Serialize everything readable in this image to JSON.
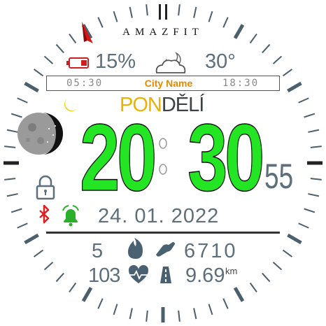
{
  "brand": "AMAZFIT",
  "battery": {
    "value": "15%",
    "color": "#cc1f1f"
  },
  "weather": {
    "temperature": "30°",
    "icon": "partly-cloudy-night-icon"
  },
  "sun": {
    "sunrise": "05:30",
    "sunset": "18:30",
    "city": "City Name"
  },
  "day": {
    "part1": "PON",
    "part2": "DĚLÍ"
  },
  "time": {
    "hours": "20",
    "minutes": "30",
    "seconds": "55"
  },
  "date": "24. 01. 2022",
  "activity": {
    "calories": "5",
    "steps": "6710",
    "heart_rate": "103",
    "distance": "9.69",
    "distance_unit": "km"
  },
  "colors": {
    "time": "#24e524",
    "accent_gray": "#5d6f7b",
    "day_yellow": "#ecb200",
    "city_orange": "#e08a00",
    "bluetooth_red": "#e02020",
    "alarm_green": "#2bb02b"
  }
}
